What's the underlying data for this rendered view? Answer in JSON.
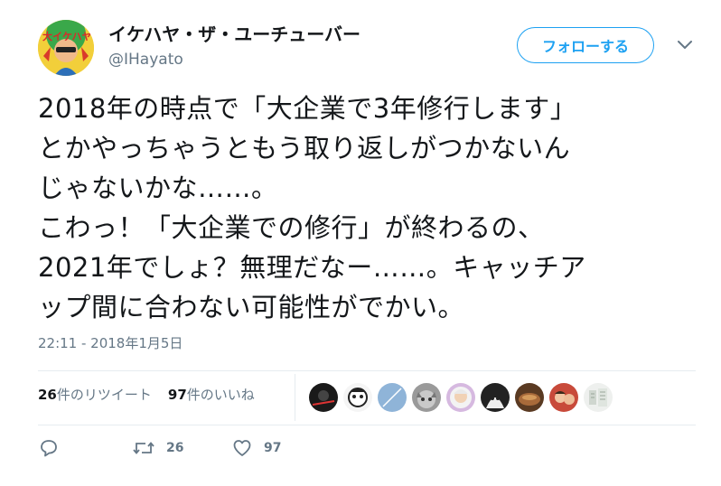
{
  "author": {
    "name": "イケハヤ・ザ・ユーチューバー",
    "handle": "@IHayato",
    "avatar_text": "大イケハヤ"
  },
  "follow_button": {
    "label": "フォローする"
  },
  "tweet": {
    "lines": [
      "2018年の時点で「大企業で3年修行します」",
      "とかやっちゃうともう取り返しがつかないん",
      "じゃないかな……。",
      "こわっ！「大企業での修行」が終わるの、",
      "2021年でしょ？無理だなー……。キャッチア",
      "ップ間に合わない可能性がでかい。"
    ],
    "timestamp": "22:11 - 2018年1月5日"
  },
  "stats": {
    "retweets_count": "26",
    "retweets_label": "件のリツイート",
    "likes_count": "97",
    "likes_label": "件のいいね"
  },
  "actions": {
    "retweet_count": "26",
    "like_count": "97"
  },
  "colors": {
    "accent": "#1da1f2",
    "muted": "#657786",
    "divider": "#e6ecf0"
  }
}
